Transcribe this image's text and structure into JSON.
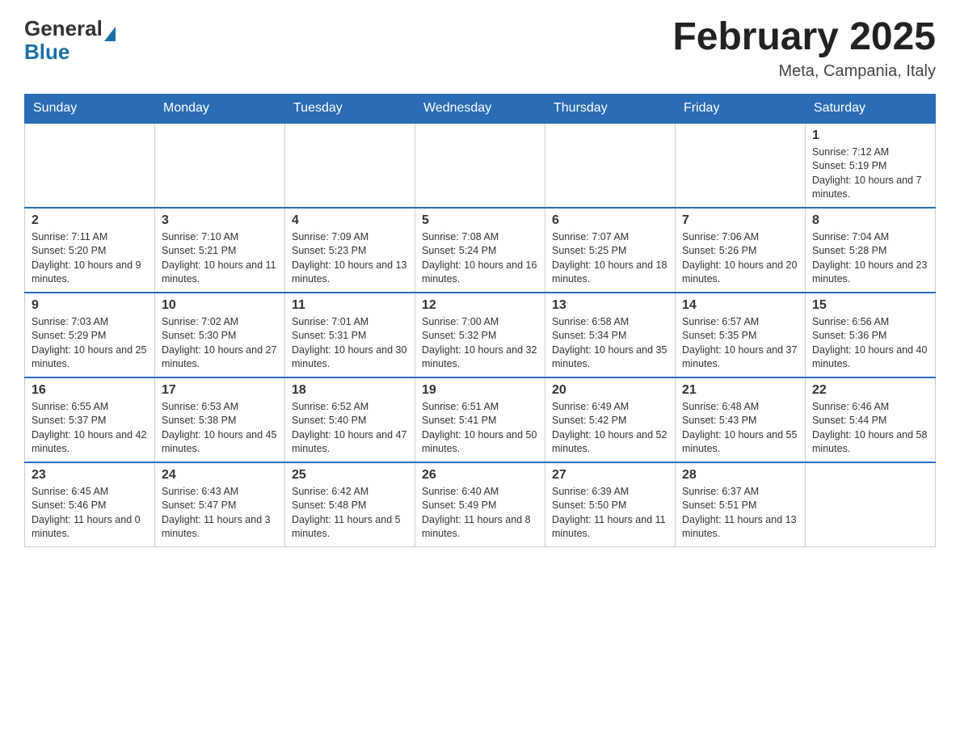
{
  "header": {
    "logo": {
      "general": "General",
      "blue": "Blue",
      "triangle_color": "#1a6ea8"
    },
    "title": "February 2025",
    "location": "Meta, Campania, Italy"
  },
  "weekdays": [
    "Sunday",
    "Monday",
    "Tuesday",
    "Wednesday",
    "Thursday",
    "Friday",
    "Saturday"
  ],
  "weeks": [
    [
      {
        "day": "",
        "info": ""
      },
      {
        "day": "",
        "info": ""
      },
      {
        "day": "",
        "info": ""
      },
      {
        "day": "",
        "info": ""
      },
      {
        "day": "",
        "info": ""
      },
      {
        "day": "",
        "info": ""
      },
      {
        "day": "1",
        "info": "Sunrise: 7:12 AM\nSunset: 5:19 PM\nDaylight: 10 hours and 7 minutes."
      }
    ],
    [
      {
        "day": "2",
        "info": "Sunrise: 7:11 AM\nSunset: 5:20 PM\nDaylight: 10 hours and 9 minutes."
      },
      {
        "day": "3",
        "info": "Sunrise: 7:10 AM\nSunset: 5:21 PM\nDaylight: 10 hours and 11 minutes."
      },
      {
        "day": "4",
        "info": "Sunrise: 7:09 AM\nSunset: 5:23 PM\nDaylight: 10 hours and 13 minutes."
      },
      {
        "day": "5",
        "info": "Sunrise: 7:08 AM\nSunset: 5:24 PM\nDaylight: 10 hours and 16 minutes."
      },
      {
        "day": "6",
        "info": "Sunrise: 7:07 AM\nSunset: 5:25 PM\nDaylight: 10 hours and 18 minutes."
      },
      {
        "day": "7",
        "info": "Sunrise: 7:06 AM\nSunset: 5:26 PM\nDaylight: 10 hours and 20 minutes."
      },
      {
        "day": "8",
        "info": "Sunrise: 7:04 AM\nSunset: 5:28 PM\nDaylight: 10 hours and 23 minutes."
      }
    ],
    [
      {
        "day": "9",
        "info": "Sunrise: 7:03 AM\nSunset: 5:29 PM\nDaylight: 10 hours and 25 minutes."
      },
      {
        "day": "10",
        "info": "Sunrise: 7:02 AM\nSunset: 5:30 PM\nDaylight: 10 hours and 27 minutes."
      },
      {
        "day": "11",
        "info": "Sunrise: 7:01 AM\nSunset: 5:31 PM\nDaylight: 10 hours and 30 minutes."
      },
      {
        "day": "12",
        "info": "Sunrise: 7:00 AM\nSunset: 5:32 PM\nDaylight: 10 hours and 32 minutes."
      },
      {
        "day": "13",
        "info": "Sunrise: 6:58 AM\nSunset: 5:34 PM\nDaylight: 10 hours and 35 minutes."
      },
      {
        "day": "14",
        "info": "Sunrise: 6:57 AM\nSunset: 5:35 PM\nDaylight: 10 hours and 37 minutes."
      },
      {
        "day": "15",
        "info": "Sunrise: 6:56 AM\nSunset: 5:36 PM\nDaylight: 10 hours and 40 minutes."
      }
    ],
    [
      {
        "day": "16",
        "info": "Sunrise: 6:55 AM\nSunset: 5:37 PM\nDaylight: 10 hours and 42 minutes."
      },
      {
        "day": "17",
        "info": "Sunrise: 6:53 AM\nSunset: 5:38 PM\nDaylight: 10 hours and 45 minutes."
      },
      {
        "day": "18",
        "info": "Sunrise: 6:52 AM\nSunset: 5:40 PM\nDaylight: 10 hours and 47 minutes."
      },
      {
        "day": "19",
        "info": "Sunrise: 6:51 AM\nSunset: 5:41 PM\nDaylight: 10 hours and 50 minutes."
      },
      {
        "day": "20",
        "info": "Sunrise: 6:49 AM\nSunset: 5:42 PM\nDaylight: 10 hours and 52 minutes."
      },
      {
        "day": "21",
        "info": "Sunrise: 6:48 AM\nSunset: 5:43 PM\nDaylight: 10 hours and 55 minutes."
      },
      {
        "day": "22",
        "info": "Sunrise: 6:46 AM\nSunset: 5:44 PM\nDaylight: 10 hours and 58 minutes."
      }
    ],
    [
      {
        "day": "23",
        "info": "Sunrise: 6:45 AM\nSunset: 5:46 PM\nDaylight: 11 hours and 0 minutes."
      },
      {
        "day": "24",
        "info": "Sunrise: 6:43 AM\nSunset: 5:47 PM\nDaylight: 11 hours and 3 minutes."
      },
      {
        "day": "25",
        "info": "Sunrise: 6:42 AM\nSunset: 5:48 PM\nDaylight: 11 hours and 5 minutes."
      },
      {
        "day": "26",
        "info": "Sunrise: 6:40 AM\nSunset: 5:49 PM\nDaylight: 11 hours and 8 minutes."
      },
      {
        "day": "27",
        "info": "Sunrise: 6:39 AM\nSunset: 5:50 PM\nDaylight: 11 hours and 11 minutes."
      },
      {
        "day": "28",
        "info": "Sunrise: 6:37 AM\nSunset: 5:51 PM\nDaylight: 11 hours and 13 minutes."
      },
      {
        "day": "",
        "info": ""
      }
    ]
  ]
}
